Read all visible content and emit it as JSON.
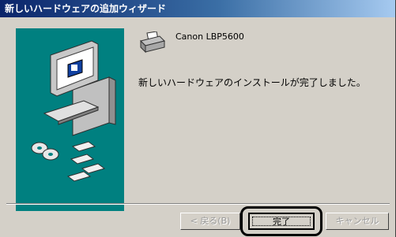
{
  "window": {
    "title": "新しいハードウェアの追加ウィザード"
  },
  "device": {
    "name": "Canon LBP5600",
    "icon": "printer-icon"
  },
  "message": "新しいハードウェアのインストールが完了しました。",
  "buttons": {
    "back": "< 戻る(B)",
    "finish": "完了",
    "cancel": "キャンセル"
  },
  "colors": {
    "panel": "#008080",
    "titlebar": "#0a246a",
    "dialog": "#d4d0c8"
  }
}
